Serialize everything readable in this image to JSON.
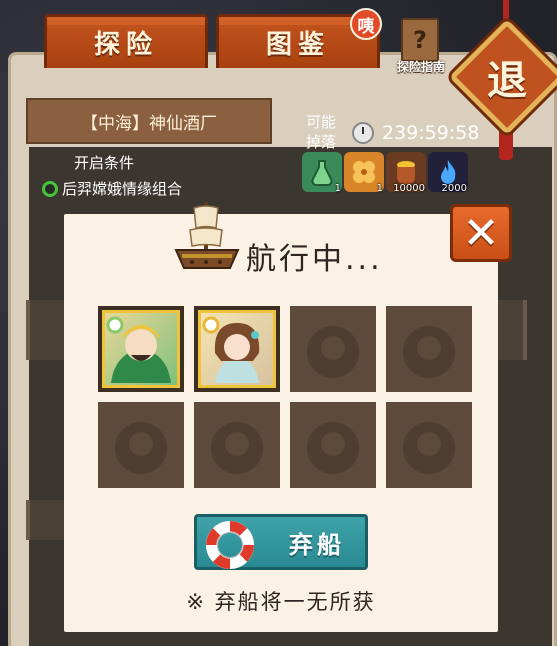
{
  "tabs": [
    {
      "label": "探险"
    },
    {
      "label": "图鉴"
    }
  ],
  "badge": {
    "label": "咦"
  },
  "guide": {
    "label": "探险指南"
  },
  "retreat": {
    "label": "退"
  },
  "stage": {
    "name": "【中海】神仙酒厂",
    "condition_title": "开启条件",
    "condition_item": "后羿嫦娥情缘组合"
  },
  "drops": {
    "label": "可能掉落",
    "timer": "239:59:58",
    "items": [
      {
        "icon": "green-potion-icon",
        "count": "1",
        "color": "#3a8a5a"
      },
      {
        "icon": "clover-coin-icon",
        "count": "1",
        "color": "#d9862a"
      },
      {
        "icon": "gold-pot-icon",
        "count": "10000",
        "color": "#6a3a22"
      },
      {
        "icon": "blue-flame-icon",
        "count": "2000",
        "color": "#23213a"
      }
    ]
  },
  "modal": {
    "title": "航行中...",
    "abandon_label": "弃船",
    "warning": "※ 弃船将一无所获",
    "slots": [
      {
        "filled": true,
        "hero": "green-warrior-hero"
      },
      {
        "filled": true,
        "hero": "girl-hero"
      },
      {
        "filled": false
      },
      {
        "filled": false
      },
      {
        "filled": false
      },
      {
        "filled": false
      },
      {
        "filled": false
      },
      {
        "filled": false
      }
    ]
  }
}
